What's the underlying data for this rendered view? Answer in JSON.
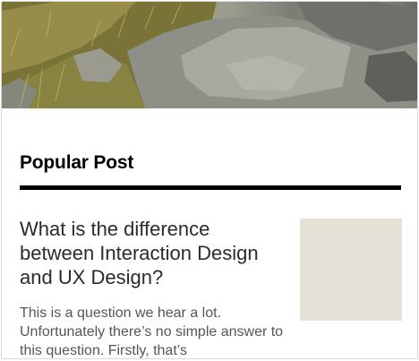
{
  "section": {
    "title": "Popular Post"
  },
  "post": {
    "title": "What is the difference between Interaction Design and UX Design?",
    "excerpt": "This is a question we hear a lot. Unfortunately there’s no simple answer to this question. Firstly, that’s"
  },
  "colors": {
    "thumbnail": "#e4e1d6",
    "rule": "#000000",
    "title_text": "#2b2b2b",
    "excerpt_text": "#555555"
  }
}
